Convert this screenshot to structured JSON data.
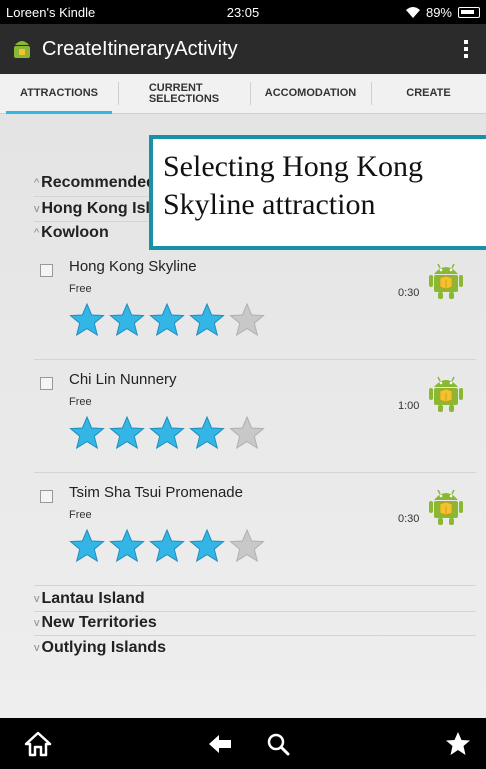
{
  "status_bar": {
    "device_name": "Loreen's Kindle",
    "time": "23:05",
    "battery": "89%"
  },
  "action_bar": {
    "title": "CreateItineraryActivity",
    "overflow_icon": "overflow-menu-icon"
  },
  "tabs": [
    {
      "label": "ATTRACTIONS",
      "active": true
    },
    {
      "label": "CURRENT",
      "sublabel": "SELECTIONS",
      "active": false
    },
    {
      "label": "ACCOMODATION",
      "active": false
    },
    {
      "label": "CREATE",
      "active": false
    }
  ],
  "groups_top": [
    {
      "label": "Recommended",
      "chevron": "^"
    },
    {
      "label": "Hong Kong Island",
      "chevron": "v"
    },
    {
      "label": "Kowloon",
      "chevron": "^"
    }
  ],
  "attractions": [
    {
      "name": "Hong Kong Skyline",
      "price": "Free",
      "duration": "0:30",
      "rating": 4,
      "max_rating": 5
    },
    {
      "name": "Chi Lin Nunnery",
      "price": "Free",
      "duration": "1:00",
      "rating": 4,
      "max_rating": 5
    },
    {
      "name": "Tsim Sha Tsui Promenade",
      "price": "Free",
      "duration": "0:30",
      "rating": 4,
      "max_rating": 5
    }
  ],
  "groups_bottom": [
    {
      "label": "Lantau Island",
      "chevron": "v"
    },
    {
      "label": "New Territories",
      "chevron": "v"
    },
    {
      "label": "Outlying Islands",
      "chevron": "v"
    }
  ],
  "callout": {
    "line1": "Selecting Hong Kong",
    "line2": "Skyline attraction"
  },
  "colors": {
    "accent": "#33b5e5",
    "star_filled": "#33b5e5",
    "star_empty": "#c8c8c8",
    "android_green": "#8ab833",
    "callout_border": "#1a8fa8"
  },
  "nav_bar": {
    "icons": [
      "home-icon",
      "back-icon",
      "search-icon",
      "favorites-star-icon"
    ]
  }
}
